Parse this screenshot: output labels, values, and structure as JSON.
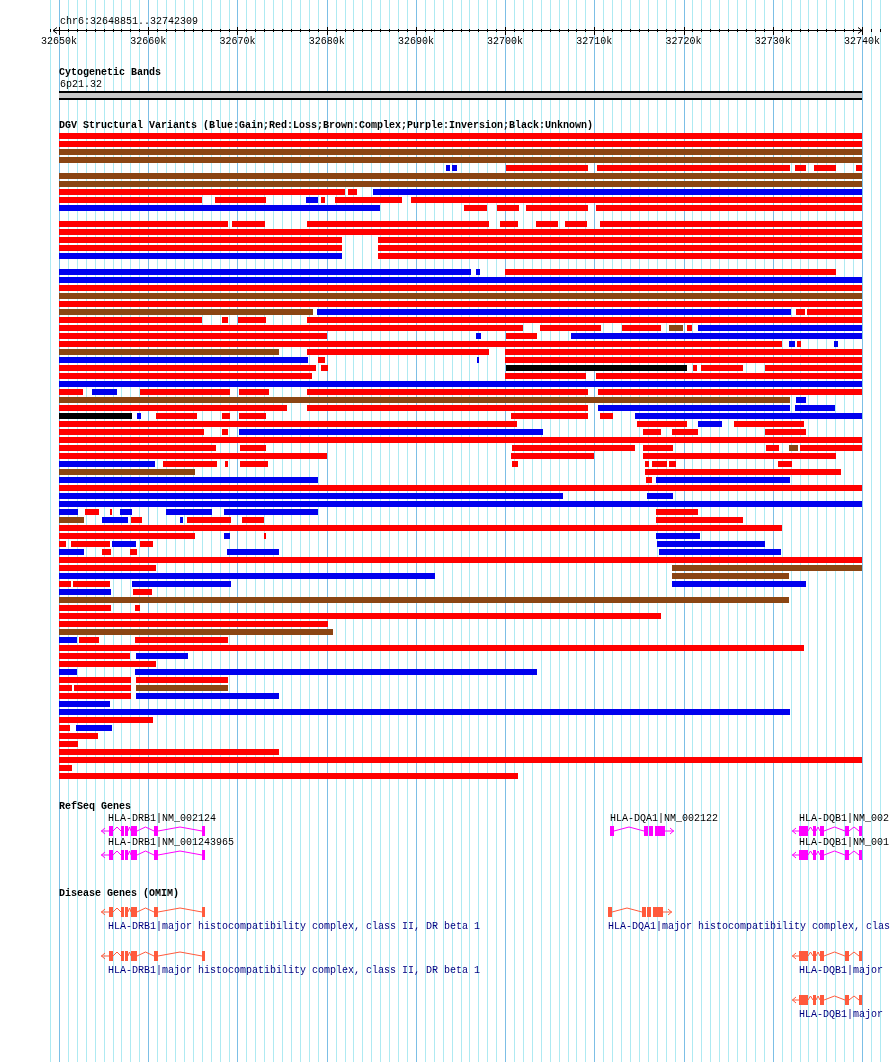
{
  "ruler": {
    "region": "chr6:32648851..32742309",
    "tick_labels": [
      "32650k",
      "32660k",
      "32670k",
      "32680k",
      "32690k",
      "32700k",
      "32710k",
      "32720k",
      "32730k",
      "32740k"
    ]
  },
  "tracks": [
    {
      "kind": "cytoband",
      "title": "Cytogenetic Bands",
      "band": "6p21.32"
    },
    {
      "kind": "variants",
      "title": "DGV Structural Variants (Blue:Gain;Red:Loss;Brown:Complex;Purple:Inversion;Black:Unknown)"
    },
    {
      "kind": "genes",
      "title": "RefSeq Genes",
      "features": [
        {
          "label": "HLA-DRB1|NM_002124"
        },
        {
          "label": "HLA-DRB1|NM_001243965"
        },
        {
          "label": "HLA-DQA1|NM_002122"
        },
        {
          "label": "HLA-DQB1|NM_002"
        },
        {
          "label": "HLA-DQB1|NM_001"
        }
      ]
    },
    {
      "kind": "disease",
      "title": "Disease Genes (OMIM)",
      "features": [
        {
          "label": "HLA-DRB1|major histocompatibility complex, class II, DR beta 1"
        },
        {
          "label": "HLA-DQA1|major histocompatibility complex, clas"
        },
        {
          "label": "HLA-DRB1|major histocompatibility complex, class II, DR beta 1"
        },
        {
          "label": "HLA-DQB1|major"
        },
        {
          "label": "HLA-DQB1|major"
        }
      ]
    }
  ]
}
